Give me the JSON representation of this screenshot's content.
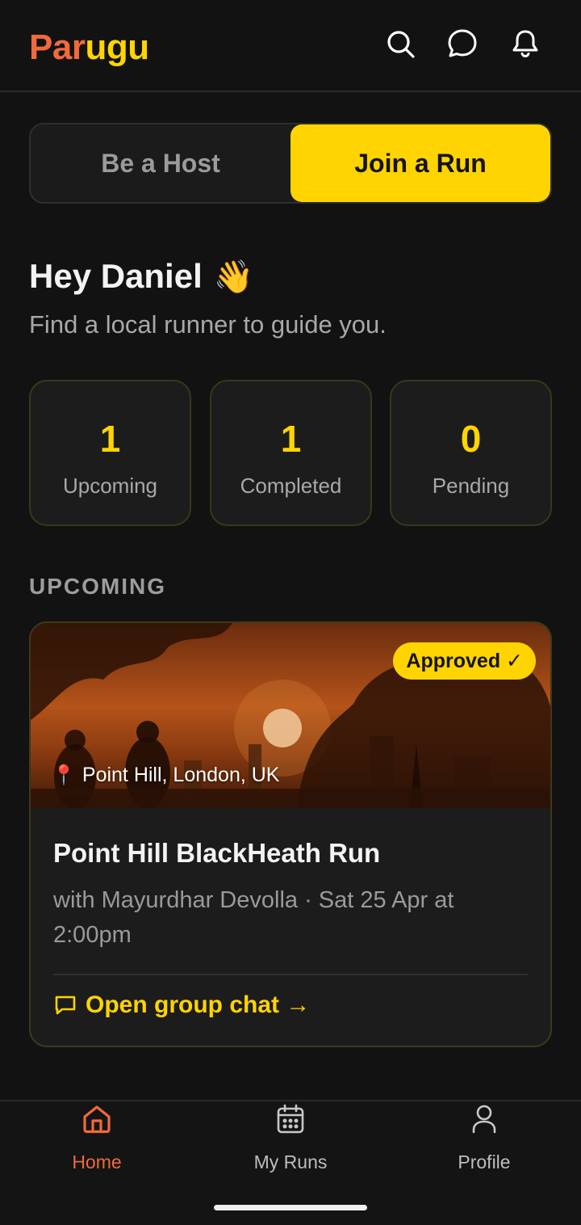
{
  "header": {
    "brand_part1": "Par",
    "brand_part2": "ugu",
    "icons": [
      "search-icon",
      "chat-bubble-icon",
      "bell-icon"
    ]
  },
  "mode_toggle": {
    "host_label": "Be a Host",
    "join_label": "Join a Run",
    "selected": "Join a Run"
  },
  "greeting": {
    "title": "Hey Daniel",
    "emoji": "👋",
    "subtitle": "Find a local runner to guide you."
  },
  "stats": [
    {
      "value": "1",
      "label": "Upcoming"
    },
    {
      "value": "1",
      "label": "Completed"
    },
    {
      "value": "0",
      "label": "Pending"
    }
  ],
  "section": {
    "upcoming_label": "UPCOMING"
  },
  "run_card": {
    "status": "Approved ✓",
    "location": "Point Hill, London, UK",
    "title": "Point Hill BlackHeath Run",
    "meta": "with Mayurdhar Devolla · Sat 25 Apr at 2:00pm",
    "chat_link": "Open group chat →"
  },
  "nav": {
    "items": [
      {
        "label": "Home",
        "icon": "home-icon",
        "active": true
      },
      {
        "label": "My Runs",
        "icon": "calendar-icon",
        "active": false
      },
      {
        "label": "Profile",
        "icon": "profile-icon",
        "active": false
      }
    ]
  },
  "colors": {
    "background": "#121212",
    "accent_yellow": "#FFD400",
    "accent_orange": "#F06A3A"
  }
}
